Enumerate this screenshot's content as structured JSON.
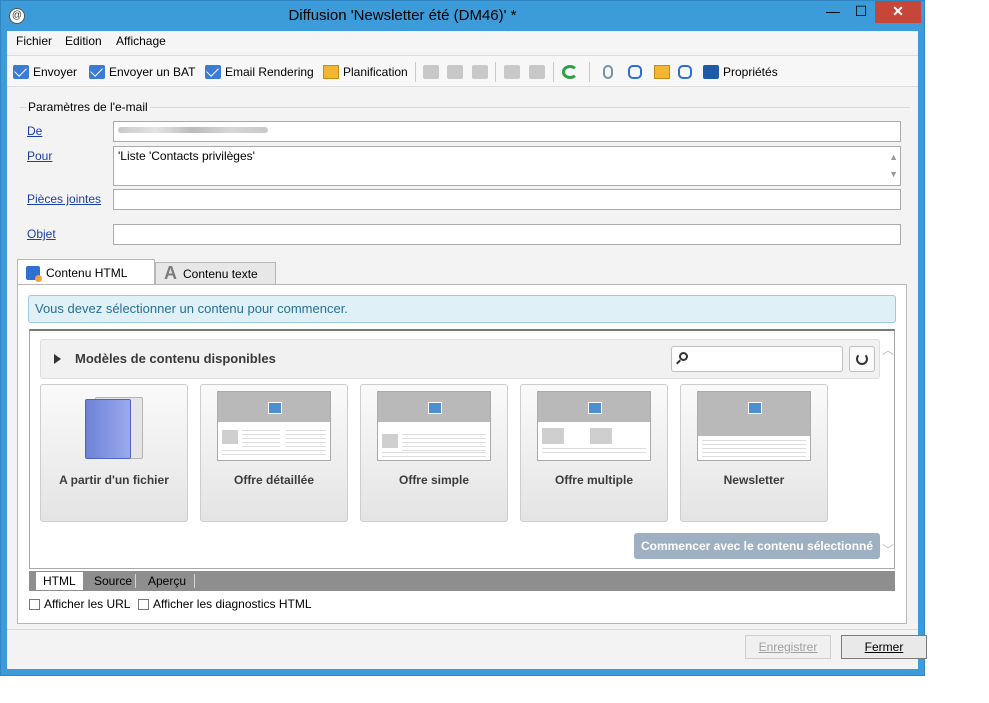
{
  "window": {
    "title": "Diffusion 'Newsletter été (DM46)' *",
    "controls": {
      "minimize": "—",
      "maximize": "☐",
      "close": "✕"
    }
  },
  "menu": {
    "items": [
      "Fichier",
      "Edition",
      "Affichage"
    ]
  },
  "toolbar": {
    "envoyer": "Envoyer",
    "envoyer_bat": "Envoyer un BAT",
    "email_rendering": "Email Rendering",
    "planification": "Planification",
    "proprietes": "Propriétés"
  },
  "params": {
    "group_title": "Paramètres de l'e-mail",
    "de_label": "De",
    "pour_label": "Pour",
    "pour_value": "'Liste 'Contacts privilèges'",
    "pieces_label": "Pièces jointes",
    "objet_label": "Objet"
  },
  "tabs": {
    "html": "Contenu HTML",
    "text": "Contenu texte"
  },
  "content": {
    "info": "Vous devez sélectionner un contenu pour commencer.",
    "models_title": "Modèles de contenu disponibles",
    "tiles": [
      "A partir d'un fichier",
      "Offre détaillée",
      "Offre simple",
      "Offre multiple",
      "Newsletter"
    ],
    "start_button": "Commencer avec le contenu sélectionné"
  },
  "subtabs": [
    "HTML",
    "Source",
    "Aperçu"
  ],
  "checkboxes": {
    "urls": "Afficher les URL",
    "diag": "Afficher les diagnostics HTML"
  },
  "footer": {
    "save": "Enregistrer",
    "close": "Fermer"
  }
}
